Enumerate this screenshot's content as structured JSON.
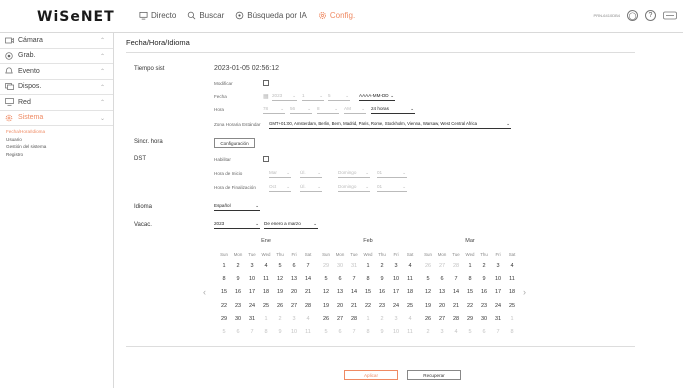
{
  "brand": {
    "logo": "WiSeNET"
  },
  "nav": [
    {
      "label": "Directo",
      "icon": "monitor-icon"
    },
    {
      "label": "Buscar",
      "icon": "search-icon"
    },
    {
      "label": "Búsqueda por IA",
      "icon": "ai-search-icon"
    },
    {
      "label": "Config.",
      "icon": "gear-icon",
      "active": true
    }
  ],
  "topright": {
    "model": "PRN-6410DB4"
  },
  "sidebar": {
    "items": [
      {
        "label": "Cámara",
        "icon": "camera-icon"
      },
      {
        "label": "Grab.",
        "icon": "record-icon"
      },
      {
        "label": "Evento",
        "icon": "event-icon"
      },
      {
        "label": "Dispos.",
        "icon": "device-icon"
      },
      {
        "label": "Red",
        "icon": "network-icon"
      },
      {
        "label": "Sistema",
        "icon": "system-icon",
        "active": true
      }
    ],
    "subitems": [
      "Fecha/Hora/Idioma",
      "Usuario",
      "Gestión del sistema",
      "Registro"
    ]
  },
  "page": {
    "title": "Fecha/Hora/Idioma",
    "system_time_label": "Tiempo sist",
    "system_time_value": "2023-01-05 02:56:12",
    "modify_label": "Modificar",
    "date_label": "Fecha",
    "date_year": "2023",
    "date_month": "1",
    "date_day": "5",
    "date_format": "AAAA-MM-DD",
    "time_label": "Hora",
    "time_hour": "78",
    "time_minute": "56",
    "time_second": "8",
    "time_ampm": "AM",
    "time_mode": "24 horas",
    "tz_label": "Zona Horaria Estándar",
    "tz_value": "GMT+01:00, Amsterdam, Berlin, Bern, Madrid, Paris, Rome, Stockholm, Vienna, Warsaw, West Central Africa",
    "sync_label": "Sincr. hora",
    "sync_button": "Configuración",
    "dst_label": "DST",
    "dst_enable_label": "Habilitar",
    "dst_start_label": "Hora de Inicio",
    "dst_end_label": "Hora de Finalización",
    "dst_start": [
      "Mar",
      "Úl.",
      "Domingo",
      "01"
    ],
    "dst_end": [
      "Oct",
      "Úl.",
      "Domingo",
      "01"
    ],
    "lang_label": "Idioma",
    "lang_value": "Español",
    "vac_label": "Vacac.",
    "vac_year": "2023",
    "vac_range": "De enero a marzo",
    "apply_button": "Aplicar",
    "recover_button": "Recuperar"
  },
  "calendar": {
    "weekdays": [
      "Sun",
      "Mon",
      "Tue",
      "Wed",
      "Thu",
      "Fri",
      "Sat"
    ],
    "months": [
      {
        "name": "Ene",
        "weeks": [
          [
            "1",
            "2",
            "3",
            "4",
            "5",
            "6",
            "7"
          ],
          [
            "8",
            "9",
            "10",
            "11",
            "12",
            "13",
            "14"
          ],
          [
            "15",
            "16",
            "17",
            "18",
            "19",
            "20",
            "21"
          ],
          [
            "22",
            "23",
            "24",
            "25",
            "26",
            "27",
            "28"
          ],
          [
            "29",
            "30",
            "31",
            "1",
            "2",
            "3",
            "4"
          ],
          [
            "5",
            "6",
            "7",
            "8",
            "9",
            "10",
            "11"
          ]
        ],
        "first": 0,
        "len": 31
      },
      {
        "name": "Feb",
        "weeks": [
          [
            "29",
            "30",
            "31",
            "1",
            "2",
            "3",
            "4"
          ],
          [
            "5",
            "6",
            "7",
            "8",
            "9",
            "10",
            "11"
          ],
          [
            "12",
            "13",
            "14",
            "15",
            "16",
            "17",
            "18"
          ],
          [
            "19",
            "20",
            "21",
            "22",
            "23",
            "24",
            "25"
          ],
          [
            "26",
            "27",
            "28",
            "1",
            "2",
            "3",
            "4"
          ],
          [
            "5",
            "6",
            "7",
            "8",
            "9",
            "10",
            "11"
          ]
        ],
        "first": 3,
        "len": 28
      },
      {
        "name": "Mar",
        "weeks": [
          [
            "26",
            "27",
            "28",
            "1",
            "2",
            "3",
            "4"
          ],
          [
            "5",
            "6",
            "7",
            "8",
            "9",
            "10",
            "11"
          ],
          [
            "12",
            "13",
            "14",
            "15",
            "16",
            "17",
            "18"
          ],
          [
            "19",
            "20",
            "21",
            "22",
            "23",
            "24",
            "25"
          ],
          [
            "26",
            "27",
            "28",
            "29",
            "30",
            "31",
            "1"
          ],
          [
            "2",
            "3",
            "4",
            "5",
            "6",
            "7",
            "8"
          ]
        ],
        "first": 3,
        "len": 31
      }
    ]
  }
}
